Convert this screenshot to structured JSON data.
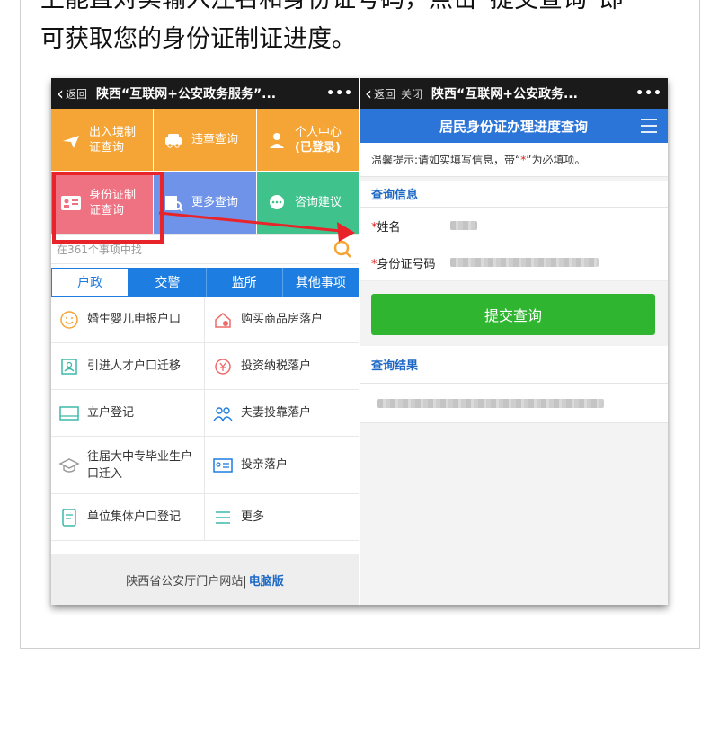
{
  "article": {
    "line1": "上能直对实输入注名和身份证号码，点击“提交查询”即",
    "line2": "可获取您的身份证制证进度。"
  },
  "left_phone": {
    "nav": {
      "back": "返回",
      "title": "陕西“互联网+公安政务服务”...",
      "more": "•••"
    },
    "tiles": [
      {
        "label1": "出入境制",
        "label2": "证查询",
        "icon": "plane-icon",
        "color": "#f5a536"
      },
      {
        "label1": "违章查询",
        "label2": "",
        "icon": "car-icon",
        "color": "#f5a536"
      },
      {
        "label1": "个人中心",
        "label2": "(已登录)",
        "icon": "user-icon",
        "color": "#f5a536"
      },
      {
        "label1": "身份证制",
        "label2": "证查询",
        "icon": "id-card-icon",
        "color": "#ef7283"
      },
      {
        "label1": "更多查询",
        "label2": "",
        "icon": "search-doc-icon",
        "color": "#6f93e8"
      },
      {
        "label1": "咨询建议",
        "label2": "",
        "icon": "chat-icon",
        "color": "#3fc28c"
      }
    ],
    "search": {
      "placeholder": "在361个事项中找"
    },
    "tabs": [
      "户政",
      "交警",
      "监所",
      "其他事项"
    ],
    "items": [
      {
        "label": "婚生婴儿申报户口",
        "icon": "baby-icon"
      },
      {
        "label": "购买商品房落户",
        "icon": "house-icon"
      },
      {
        "label": "引进人才户口迁移",
        "icon": "talent-icon"
      },
      {
        "label": "投资纳税落户",
        "icon": "yuan-icon"
      },
      {
        "label": "立户登记",
        "icon": "register-icon"
      },
      {
        "label": "夫妻投靠落户",
        "icon": "couple-icon"
      },
      {
        "label": "往届大中专毕业生户口迁入",
        "icon": "graduate-icon"
      },
      {
        "label": "投亲落户",
        "icon": "relatives-icon"
      },
      {
        "label": "单位集体户口登记",
        "icon": "form-icon"
      },
      {
        "label": "更多",
        "icon": "list-icon"
      }
    ],
    "footer": {
      "text": "陕西省公安厅门户网站|",
      "link": "电脑版"
    }
  },
  "right_phone": {
    "nav": {
      "back": "返回",
      "close": "关闭",
      "title": "陕西“互联网+公安政务...",
      "more": "•••"
    },
    "header": "居民身份证办理进度查询",
    "tip_prefix": "温馨提示:请如实填写信息，带“",
    "tip_star": "*",
    "tip_suffix": "”为必填项。",
    "section": "查询信息",
    "fields": [
      {
        "label": "姓名"
      },
      {
        "label": "身份证号码"
      }
    ],
    "required_mark": "*",
    "submit": "提交查询",
    "result_title": "查询结果"
  },
  "colors": {
    "accent_blue": "#1d7de0",
    "submit_green": "#2fb52f",
    "highlight_red": "#e8242a"
  }
}
